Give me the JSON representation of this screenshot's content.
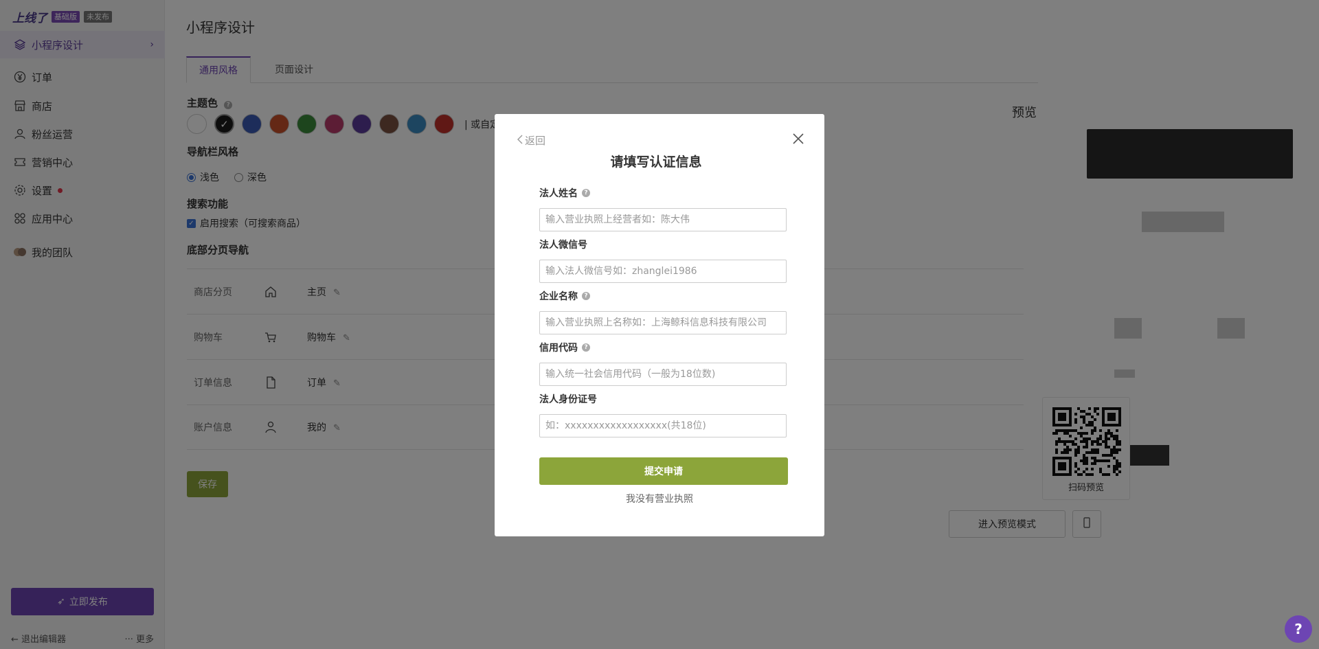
{
  "sidebar": {
    "brand": "上线了",
    "badge_edition": "基础版",
    "badge_status": "未发布",
    "items": [
      {
        "label": "小程序设计",
        "icon": "layers-icon"
      },
      {
        "label": "订单",
        "icon": "yen-icon"
      },
      {
        "label": "商店",
        "icon": "store-icon"
      },
      {
        "label": "粉丝运营",
        "icon": "user-icon"
      },
      {
        "label": "营销中心",
        "icon": "ticket-icon"
      },
      {
        "label": "设置",
        "icon": "gear-icon"
      },
      {
        "label": "应用中心",
        "icon": "apps-icon"
      },
      {
        "label": "我的团队",
        "icon": "team-avatar-icon"
      }
    ],
    "publish_label": "立即发布",
    "exit_label": "退出编辑器",
    "more_label": "更多"
  },
  "main": {
    "page_title": "小程序设计",
    "tabs": [
      {
        "label": "通用风格"
      },
      {
        "label": "页面设计"
      }
    ],
    "theme_color_title": "主题色",
    "theme_colors": [
      "#ffffff",
      "#1a1a1a",
      "#3b5bb5",
      "#c8502a",
      "#3a8a3a",
      "#b83a6a",
      "#5a3a9a",
      "#7a5040",
      "#3a8ac0",
      "#c0302a"
    ],
    "custom_color_text": "| 或自定",
    "navbar_style_title": "导航栏风格",
    "navbar_options": [
      "浅色",
      "深色"
    ],
    "search_title": "搜索功能",
    "search_checkbox_label": "启用搜索（可搜索商品）",
    "bottom_nav_title": "底部分页导航",
    "bottom_nav": [
      {
        "name": "商店分页",
        "icon": "home-icon",
        "label": "主页"
      },
      {
        "name": "购物车",
        "icon": "cart-icon",
        "label": "购物车"
      },
      {
        "name": "订单信息",
        "icon": "document-icon",
        "label": "订单"
      },
      {
        "name": "账户信息",
        "icon": "person-icon",
        "label": "我的"
      }
    ],
    "save_label": "保存"
  },
  "preview": {
    "title": "预览",
    "qr_label": "扫码预览",
    "enter_preview_label": "进入预览模式"
  },
  "modal": {
    "back_label": "返回",
    "title": "请填写认证信息",
    "fields": [
      {
        "label": "法人姓名",
        "placeholder": "输入营业执照上经营者如：陈大伟",
        "value": ""
      },
      {
        "label": "法人微信号",
        "placeholder": "输入法人微信号如：zhanglei1986",
        "value": ""
      },
      {
        "label": "企业名称",
        "placeholder": "输入营业执照上名称如：上海鲸科信息科技有限公司",
        "value": ""
      },
      {
        "label": "信用代码",
        "placeholder": "输入统一社会信用代码（一般为18位数)",
        "value": ""
      },
      {
        "label": "法人身份证号",
        "placeholder": "如：xxxxxxxxxxxxxxxxxx(共18位)",
        "value": ""
      }
    ],
    "submit_label": "提交申请",
    "no_license_label": "我没有营业执照"
  },
  "help_label": "?"
}
